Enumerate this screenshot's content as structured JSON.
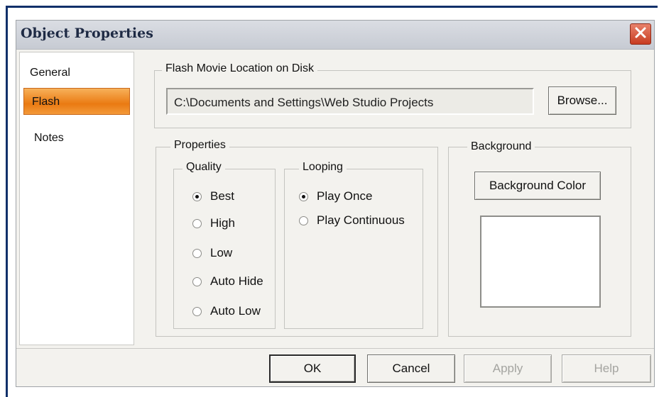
{
  "dialog": {
    "title": "Object Properties"
  },
  "sidebar": {
    "items": [
      "General",
      "Flash",
      "Notes"
    ],
    "selected": "Flash"
  },
  "flash_location": {
    "legend": "Flash Movie Location on Disk",
    "path_value": "C:\\Documents and Settings\\Web Studio Projects",
    "browse_label": "Browse..."
  },
  "properties": {
    "legend": "Properties",
    "quality": {
      "legend": "Quality",
      "options": [
        "Best",
        "High",
        "Low",
        "Auto Hide",
        "Auto Low"
      ],
      "selected": "Best"
    },
    "looping": {
      "legend": "Looping",
      "options": [
        "Play Once",
        "Play Continuous"
      ],
      "selected": "Play Once"
    }
  },
  "background": {
    "legend": "Background",
    "button_label": "Background Color",
    "swatch_color": "#ffffff"
  },
  "buttons": {
    "ok": "OK",
    "cancel": "Cancel",
    "apply": "Apply",
    "help": "Help"
  },
  "colors": {
    "selected_item": "#f08a20",
    "close_button": "#d9472a",
    "frame": "#10306a"
  },
  "icons": {
    "close": "close-x-icon"
  }
}
